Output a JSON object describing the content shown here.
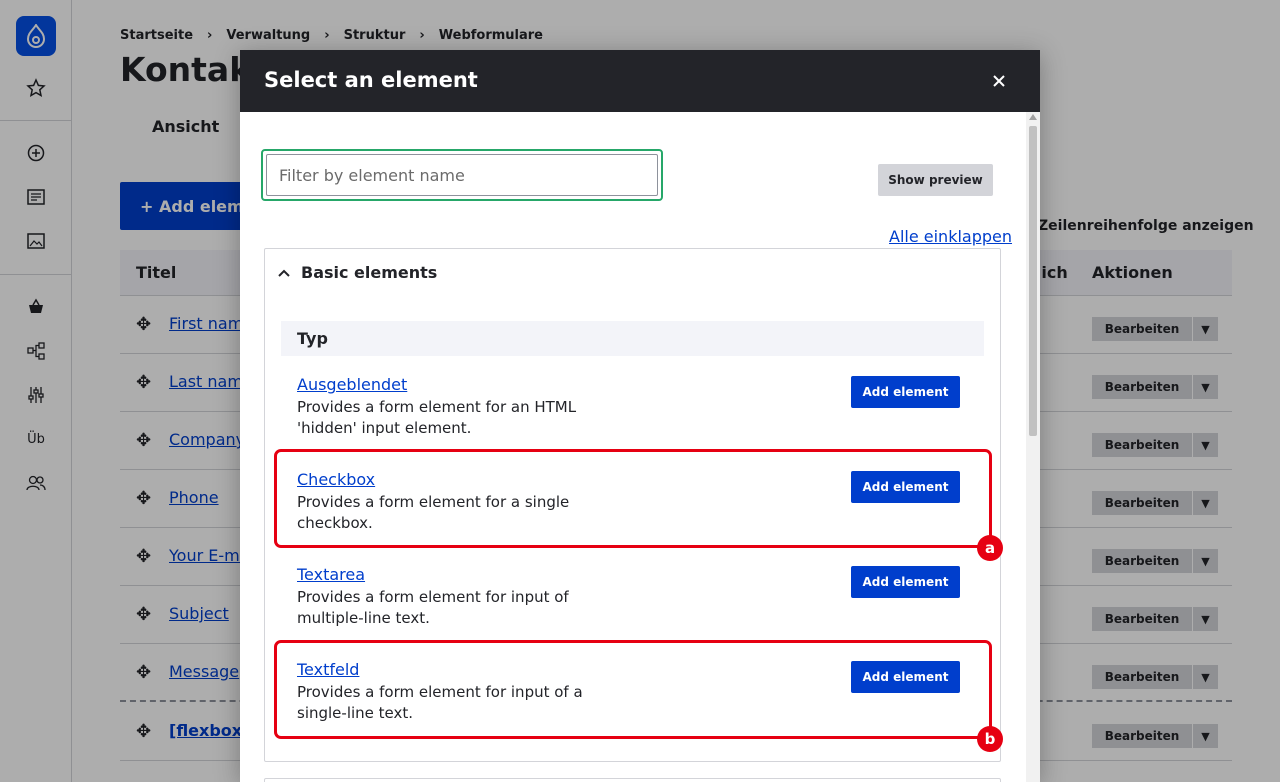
{
  "breadcrumb": [
    "Startseite",
    "Verwaltung",
    "Struktur",
    "Webformulare"
  ],
  "page": {
    "title": "Kontakt",
    "tab_view": "Ansicht",
    "add_element_button": "+ Add element",
    "row_order_link": "Zeilenreihenfolge anzeigen",
    "columns": {
      "title": "Titel",
      "required": "rlich",
      "actions": "Aktionen"
    },
    "rows": [
      {
        "title": "First name"
      },
      {
        "title": "Last name"
      },
      {
        "title": "Company"
      },
      {
        "title": "Phone"
      },
      {
        "title": "Your E-mail"
      },
      {
        "title": "Subject"
      },
      {
        "title": "Message"
      },
      {
        "title": "[flexbox_"
      }
    ],
    "edit_label": "Bearbeiten"
  },
  "rail": {
    "short_label": "Üb"
  },
  "modal": {
    "title": "Select an element",
    "filter_placeholder": "Filter by element name",
    "show_preview": "Show preview",
    "collapse_all": "Alle einklappen",
    "group_title": "Basic elements",
    "column_header": "Typ",
    "add_label": "Add element",
    "elements": [
      {
        "name": "Ausgeblendet",
        "description": "Provides a form element for an HTML 'hidden' input element."
      },
      {
        "name": "Checkbox",
        "description": "Provides a form element for a single checkbox."
      },
      {
        "name": "Textarea",
        "description": "Provides a form element for input of multiple-line text."
      },
      {
        "name": "Textfeld",
        "description": "Provides a form element for input of a single-line text."
      }
    ]
  },
  "annotations": [
    {
      "label": "a"
    },
    {
      "label": "b"
    }
  ],
  "colors": {
    "primary": "#003ecc",
    "modal_header": "#232429",
    "focus": "#26a769",
    "highlight": "#e60012"
  }
}
